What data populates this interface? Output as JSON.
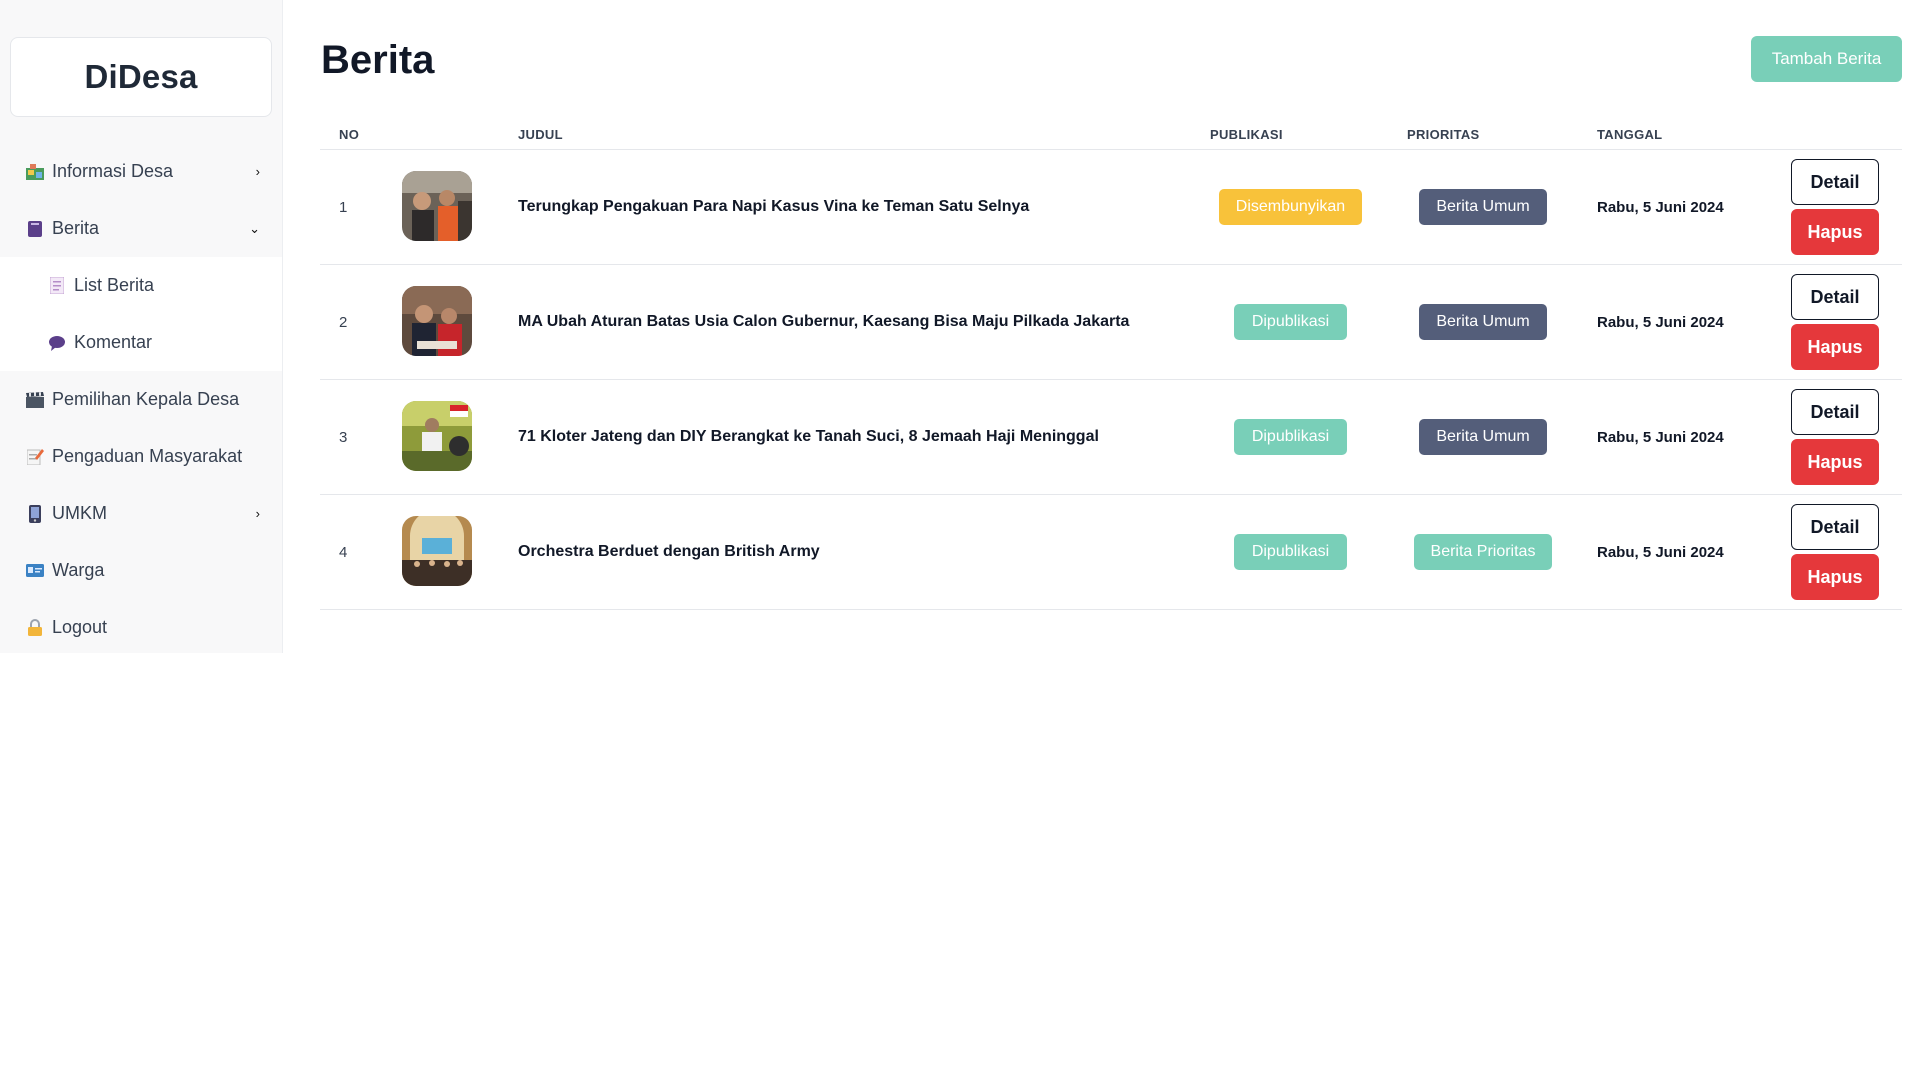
{
  "app": {
    "brand": "DiDesa"
  },
  "sidebar": {
    "items": [
      {
        "label": "Informasi Desa",
        "icon": "map-icon",
        "chevron": "›"
      },
      {
        "label": "Berita",
        "icon": "book-icon",
        "chevron": "⌄"
      },
      {
        "label": "List Berita",
        "icon": "page-icon"
      },
      {
        "label": "Komentar",
        "icon": "speech-bubble-icon"
      },
      {
        "label": "Pemilihan Kepala Desa",
        "icon": "clapper-icon"
      },
      {
        "label": "Pengaduan Masyarakat",
        "icon": "memo-icon"
      },
      {
        "label": "UMKM",
        "icon": "phone-icon",
        "chevron": "›"
      },
      {
        "label": "Warga",
        "icon": "id-card-icon"
      },
      {
        "label": "Logout",
        "icon": "lock-icon"
      }
    ]
  },
  "header": {
    "title": "Berita",
    "add_button": "Tambah Berita"
  },
  "table": {
    "columns": {
      "no": "NO",
      "judul": "JUDUL",
      "publikasi": "PUBLIKASI",
      "prioritas": "PRIORITAS",
      "tanggal": "TANGGAL"
    },
    "rows": [
      {
        "no": "1",
        "judul": "Terungkap Pengakuan Para Napi Kasus Vina ke Teman Satu Selnya",
        "publikasi": "Disembunyikan",
        "prioritas": "Berita Umum",
        "tanggal": "Rabu, 5 Juni 2024",
        "detail": "Detail",
        "hapus": "Hapus"
      },
      {
        "no": "2",
        "judul": "MA Ubah Aturan Batas Usia Calon Gubernur, Kaesang Bisa Maju Pilkada Jakarta",
        "publikasi": "Dipublikasi",
        "prioritas": "Berita Umum",
        "tanggal": "Rabu, 5 Juni 2024",
        "detail": "Detail",
        "hapus": "Hapus"
      },
      {
        "no": "3",
        "judul": "71 Kloter Jateng dan DIY Berangkat ke Tanah Suci, 8 Jemaah Haji Meninggal",
        "publikasi": "Dipublikasi",
        "prioritas": "Berita Umum",
        "tanggal": "Rabu, 5 Juni 2024",
        "detail": "Detail",
        "hapus": "Hapus"
      },
      {
        "no": "4",
        "judul": "Orchestra Berduet dengan British Army",
        "publikasi": "Dipublikasi",
        "prioritas": "Berita Prioritas",
        "tanggal": "Rabu, 5 Juni 2024",
        "detail": "Detail",
        "hapus": "Hapus"
      }
    ]
  },
  "colors": {
    "hidden_badge": "#f8c23a",
    "published_badge": "#79cfb8",
    "umum_badge": "#545e7a",
    "prioritas_badge": "#79cfb8",
    "danger": "#e5383b"
  }
}
